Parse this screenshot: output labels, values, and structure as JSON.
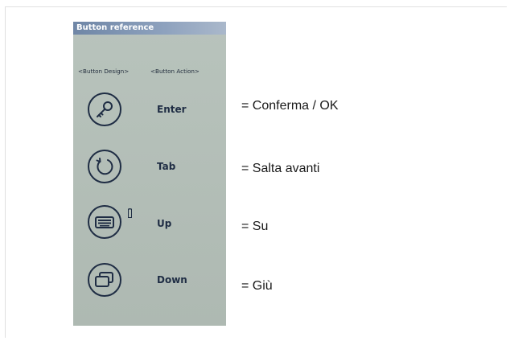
{
  "panel": {
    "title": "Button reference",
    "headers": {
      "design": "<Button Design>",
      "action": "<Button Action>"
    }
  },
  "rows": [
    {
      "icon": "key-icon",
      "action": "Enter",
      "meaning": "= Conferma / OK"
    },
    {
      "icon": "refresh-icon",
      "action": "Tab",
      "meaning": "= Salta avanti"
    },
    {
      "icon": "keyboard-icon",
      "action": "Up",
      "meaning": "= Su"
    },
    {
      "icon": "windows-icon",
      "action": "Down",
      "meaning": "= Giù"
    }
  ],
  "colors": {
    "panel_bg": "#b4bfb8",
    "title_bar": "#7b90ae",
    "icon_stroke": "#1f2d44"
  }
}
